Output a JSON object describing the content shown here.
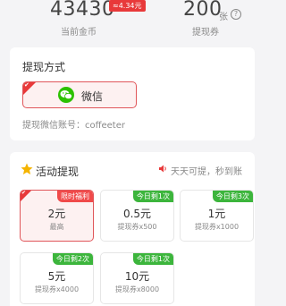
{
  "stats": {
    "coins": {
      "value": "43430",
      "badge": "≈4.34元",
      "label": "当前金币"
    },
    "tickets": {
      "value": "200",
      "unit": "张",
      "label": "提现券"
    }
  },
  "withdraw_method": {
    "title": "提现方式",
    "option_label": "微信",
    "account_line": "提现微信账号：coffeeter"
  },
  "activity": {
    "title": "活动提现",
    "note": "天天可提，秒到账",
    "tiles": [
      {
        "tag": "限时福利",
        "amount": "2元",
        "sub": "最高",
        "selected": true
      },
      {
        "tag": "今日剩1次",
        "amount": "0.5元",
        "sub": "提现券x500"
      },
      {
        "tag": "今日剩3次",
        "amount": "1元",
        "sub": "提现券x1000"
      },
      {
        "tag": "今日剩2次",
        "amount": "5元",
        "sub": "提现券x4000"
      },
      {
        "tag": "今日剩1次",
        "amount": "10元",
        "sub": "提现券x8000"
      }
    ]
  }
}
